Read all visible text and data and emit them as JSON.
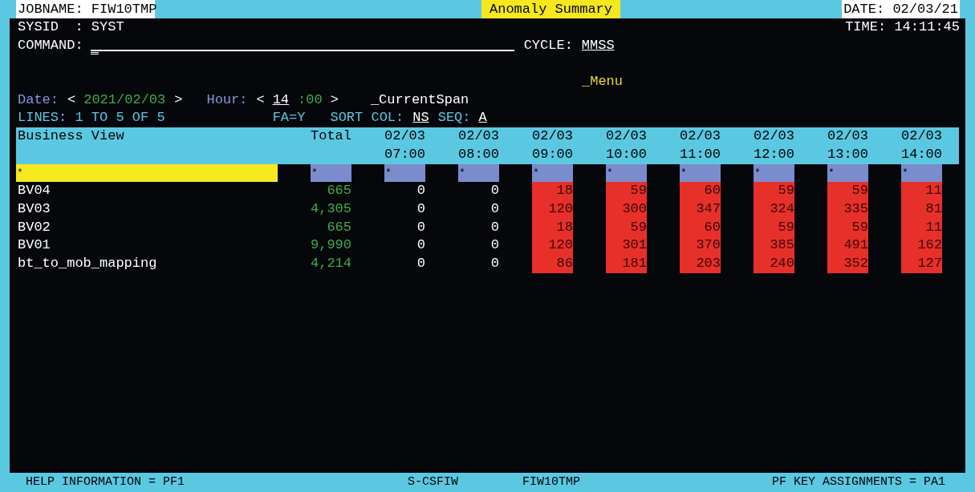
{
  "header": {
    "jobname": "JOBNAME: FIW10TMP",
    "title": "Anomaly Summary",
    "date": "DATE: 02/03/21"
  },
  "sysid": "SYSID  : SYST",
  "time": "TIME: 14:11:45",
  "command": {
    "label": "COMMAND:"
  },
  "cycle": {
    "label": "CYCLE:",
    "value": "MMSS"
  },
  "menu": "_Menu",
  "date_nav": {
    "label": "Date:",
    "prev": "<",
    "value": "2021/02/03",
    "next": ">"
  },
  "hour_nav": {
    "label": "Hour:",
    "prev": "<",
    "hour": "14",
    "minutes": ":00",
    "next": ">"
  },
  "current_span": "_CurrentSpan",
  "lines": "LINES: 1 TO 5 OF 5",
  "fa": "FA=Y",
  "sort": {
    "label": "SORT COL:",
    "value": "NS"
  },
  "seq": {
    "label": "SEQ:",
    "value": "A"
  },
  "table": {
    "columns": [
      {
        "kind": "name",
        "label": "Business View",
        "filter": "*"
      },
      {
        "kind": "total",
        "label": "Total",
        "filter": "*"
      },
      {
        "kind": "hour",
        "date": "02/03",
        "time": "07:00",
        "filter": "*",
        "flagged": false
      },
      {
        "kind": "hour",
        "date": "02/03",
        "time": "08:00",
        "filter": "*",
        "flagged": false
      },
      {
        "kind": "hour",
        "date": "02/03",
        "time": "09:00",
        "filter": "*",
        "flagged": true
      },
      {
        "kind": "hour",
        "date": "02/03",
        "time": "10:00",
        "filter": "*",
        "flagged": true
      },
      {
        "kind": "hour",
        "date": "02/03",
        "time": "11:00",
        "filter": "*",
        "flagged": true
      },
      {
        "kind": "hour",
        "date": "02/03",
        "time": "12:00",
        "filter": "*",
        "flagged": true
      },
      {
        "kind": "hour",
        "date": "02/03",
        "time": "13:00",
        "filter": "*",
        "flagged": true
      },
      {
        "kind": "hour",
        "date": "02/03",
        "time": "14:00",
        "filter": "*",
        "flagged": true
      }
    ],
    "rows": [
      {
        "name": "BV04",
        "total": "665",
        "values": [
          "0",
          "0",
          "18",
          "59",
          "60",
          "59",
          "59",
          "11"
        ]
      },
      {
        "name": "BV03",
        "total": "4,305",
        "values": [
          "0",
          "0",
          "120",
          "300",
          "347",
          "324",
          "335",
          "81"
        ]
      },
      {
        "name": "BV02",
        "total": "665",
        "values": [
          "0",
          "0",
          "18",
          "59",
          "60",
          "59",
          "59",
          "11"
        ]
      },
      {
        "name": "BV01",
        "total": "9,990",
        "values": [
          "0",
          "0",
          "120",
          "301",
          "370",
          "385",
          "491",
          "162"
        ]
      },
      {
        "name": "bt_to_mob_mapping",
        "total": "4,214",
        "values": [
          "0",
          "0",
          "86",
          "181",
          "203",
          "240",
          "352",
          "127"
        ]
      }
    ]
  },
  "status_bar": {
    "help": "HELP INFORMATION = PF1",
    "program": "S-CSFIW",
    "job": "FIW10TMP",
    "keys": "PF KEY ASSIGNMENTS = PA1"
  }
}
